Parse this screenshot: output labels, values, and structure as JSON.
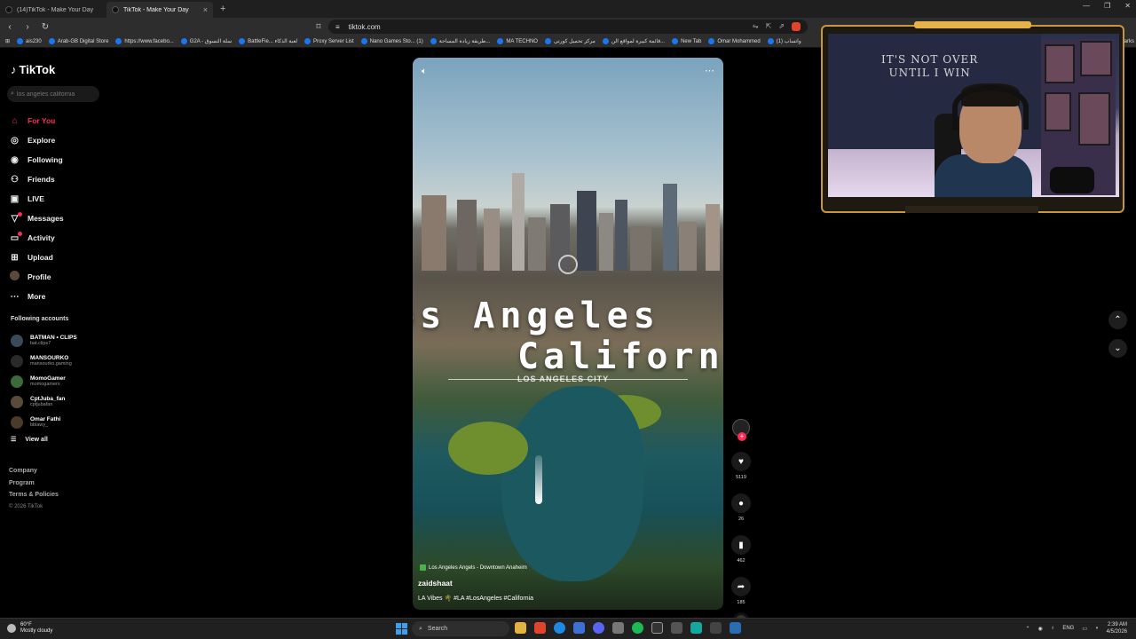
{
  "browser": {
    "tabs": [
      {
        "title": "(14)TikTok - Make Your Day",
        "active": false
      },
      {
        "title": "TikTok - Make Your Day",
        "active": true
      }
    ],
    "new_tab_label": "+",
    "url": "tiktok.com",
    "bookmarks": [
      "ais230",
      "Arab-GB Digital Store",
      "https://www.facebo...",
      "G2A - سلة التسوق",
      "BattleFie... لعبة الذكاء",
      "Proxy Server List",
      "Nano Games Sto... (1)",
      "طريقة زيادة المساحة...",
      "MA TECHNO",
      "مركز تحميل كورتي",
      "قائمة كبيرة لمواقع الن...",
      "New Tab",
      "Omar Mohammed",
      "(1) واتساب"
    ],
    "bookmarks_more": "arks"
  },
  "sidebar": {
    "logo": "TikTok",
    "search_placeholder": "los angeles california",
    "nav": [
      {
        "label": "For You",
        "icon": "home-icon",
        "glyph": "⌂",
        "active": true
      },
      {
        "label": "Explore",
        "icon": "compass-icon",
        "glyph": "◎",
        "active": false
      },
      {
        "label": "Following",
        "icon": "following-icon",
        "glyph": "◉",
        "active": false
      },
      {
        "label": "Friends",
        "icon": "friends-icon",
        "glyph": "⚇",
        "active": false
      },
      {
        "label": "LIVE",
        "icon": "live-icon",
        "glyph": "▣",
        "active": false
      },
      {
        "label": "Messages",
        "icon": "messages-icon",
        "glyph": "▽",
        "active": false,
        "badge": true
      },
      {
        "label": "Activity",
        "icon": "activity-icon",
        "glyph": "▭",
        "active": false,
        "badge": true
      },
      {
        "label": "Upload",
        "icon": "upload-icon",
        "glyph": "⊞",
        "active": false
      },
      {
        "label": "Profile",
        "icon": "profile-avatar",
        "glyph": "",
        "active": false
      },
      {
        "label": "More",
        "icon": "more-icon",
        "glyph": "⋯",
        "active": false
      }
    ],
    "following_title": "Following accounts",
    "accounts": [
      {
        "name": "BATMAN • CLIPS",
        "handle": "bat.clips7"
      },
      {
        "name": "MANSOURKO",
        "handle": "mansourko.gaming"
      },
      {
        "name": "MomoGamer",
        "handle": "momogamerx"
      },
      {
        "name": "CptJuba_fan",
        "handle": "cptjubafan"
      },
      {
        "name": "Omar Fathi",
        "handle": "bblawy_"
      }
    ],
    "view_all": "View all",
    "footer": [
      "Company",
      "Program",
      "Terms & Policies"
    ],
    "copyright": "© 2026 TikTok"
  },
  "video": {
    "overlay_line1": "os Angeles",
    "overlay_line2": "California",
    "overlay_sub": "LOS ANGELES CITY",
    "location": "Los Angeles Angels - Downtown Anaheim",
    "author": "zaidshaat",
    "caption": "LA Vibes 🌴 #LA #LosAngeles #California",
    "likes": "5119",
    "comments": "26",
    "saves": "462",
    "shares": "185"
  },
  "webcam": {
    "poster_line1": "IT'S NOT OVER",
    "poster_line2": "UNTIL I WIN"
  },
  "taskbar": {
    "weather_temp": "60°F",
    "weather_desc": "Mostly cloudy",
    "search_label": "Search",
    "language": "ENG",
    "time": "2:39 AM",
    "date": "4/5/2026"
  },
  "colors": {
    "accent": "#fe2c55",
    "background": "#000000"
  }
}
